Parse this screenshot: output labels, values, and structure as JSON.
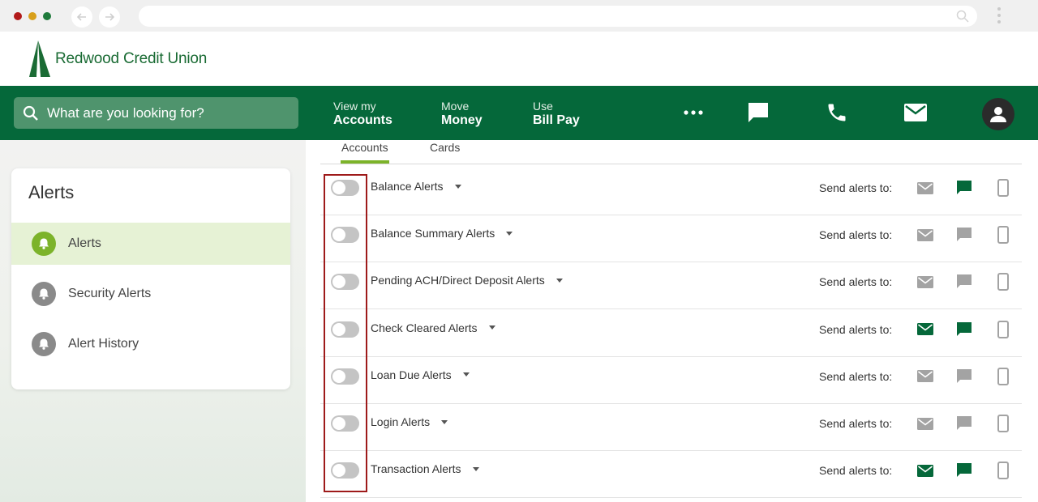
{
  "logo": {
    "brand": "Redwood Credit Union"
  },
  "search": {
    "placeholder": "What are you looking for?"
  },
  "nav": [
    {
      "small": "View my",
      "big": "Accounts"
    },
    {
      "small": "Move",
      "big": "Money"
    },
    {
      "small": "Use",
      "big": "Bill Pay"
    }
  ],
  "nav_icons": [
    "more-dots-icon",
    "chat-icon",
    "phone-icon",
    "mail-icon",
    "user-avatar-icon"
  ],
  "sidebar": {
    "title": "Alerts",
    "items": [
      {
        "label": "Alerts",
        "active": true
      },
      {
        "label": "Security Alerts",
        "active": false
      },
      {
        "label": "Alert History",
        "active": false
      }
    ]
  },
  "tabs": [
    {
      "label": "Accounts",
      "active": true
    },
    {
      "label": "Cards",
      "active": false
    }
  ],
  "send_label": "Send alerts to:",
  "alerts": [
    {
      "name": "Balance Alerts",
      "enabled": false,
      "email": false,
      "text": true,
      "device": false
    },
    {
      "name": "Balance Summary Alerts",
      "enabled": false,
      "email": false,
      "text": false,
      "device": false
    },
    {
      "name": "Pending ACH/Direct Deposit Alerts",
      "enabled": false,
      "email": false,
      "text": false,
      "device": false
    },
    {
      "name": "Check Cleared Alerts",
      "enabled": false,
      "email": true,
      "text": true,
      "device": false
    },
    {
      "name": "Loan Due Alerts",
      "enabled": false,
      "email": false,
      "text": false,
      "device": false
    },
    {
      "name": "Login Alerts",
      "enabled": false,
      "email": false,
      "text": false,
      "device": false
    },
    {
      "name": "Transaction Alerts",
      "enabled": false,
      "email": true,
      "text": true,
      "device": false
    }
  ],
  "colors": {
    "brand_green": "#05683a",
    "accent_green": "#7cb32a",
    "channel_on": "#05683a",
    "channel_off": "#a3a3a3",
    "highlight_box": "#9e1a1a"
  }
}
